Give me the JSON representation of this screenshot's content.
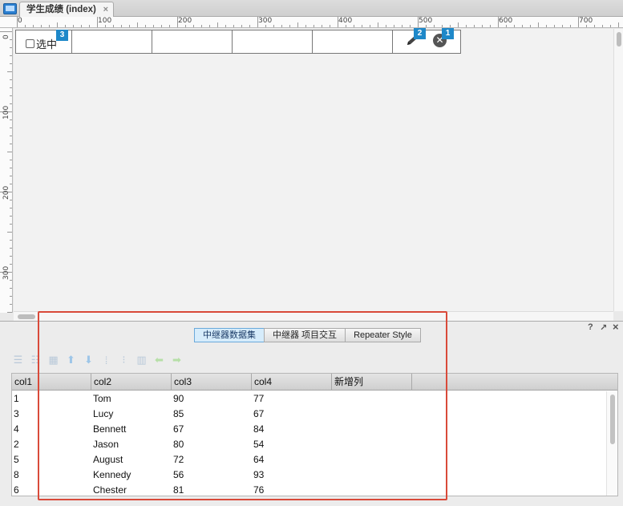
{
  "tab": {
    "title": "学生成绩 (index)",
    "close": "×"
  },
  "ruler": {
    "top_labels": [
      "0",
      "100",
      "200",
      "300",
      "400",
      "500",
      "600",
      "700"
    ],
    "left_labels": [
      "0",
      "100",
      "200",
      "300"
    ]
  },
  "repeater": {
    "checkbox_label": "选中",
    "badges": {
      "checkbox": "3",
      "edit": "2",
      "delete": "1"
    },
    "delete_glyph": "✕"
  },
  "panel": {
    "controls": {
      "help": "?",
      "popout": "↗",
      "close": "×"
    },
    "tabs": [
      {
        "label": "中继器数据集",
        "active": true
      },
      {
        "label": "中继器 项目交互",
        "active": false
      },
      {
        "label": "Repeater Style",
        "active": false
      }
    ],
    "toolbar_icons": [
      "insert-row-icon",
      "delete-row-icon",
      "insert-column-icon",
      "move-up-icon",
      "move-down-icon",
      "move-column-left-icon",
      "move-column-right-icon",
      "delete-column-icon",
      "move-left-icon",
      "move-right-icon"
    ]
  },
  "grid": {
    "columns": [
      "col1",
      "col2",
      "col3",
      "col4",
      "新增列"
    ],
    "rows": [
      [
        "1",
        "Tom",
        "90",
        "77"
      ],
      [
        "3",
        "Lucy",
        "85",
        "67"
      ],
      [
        "4",
        "Bennett",
        "67",
        "84"
      ],
      [
        "2",
        "Jason",
        "80",
        "54"
      ],
      [
        "5",
        "August",
        "72",
        "64"
      ],
      [
        "8",
        "Kennedy",
        "56",
        "93"
      ],
      [
        "6",
        "Chester",
        "81",
        "76"
      ]
    ]
  },
  "colors": {
    "accent": "#1e88c9",
    "highlight_border": "#d94a3a",
    "active_tab": "#d6ecfb"
  }
}
